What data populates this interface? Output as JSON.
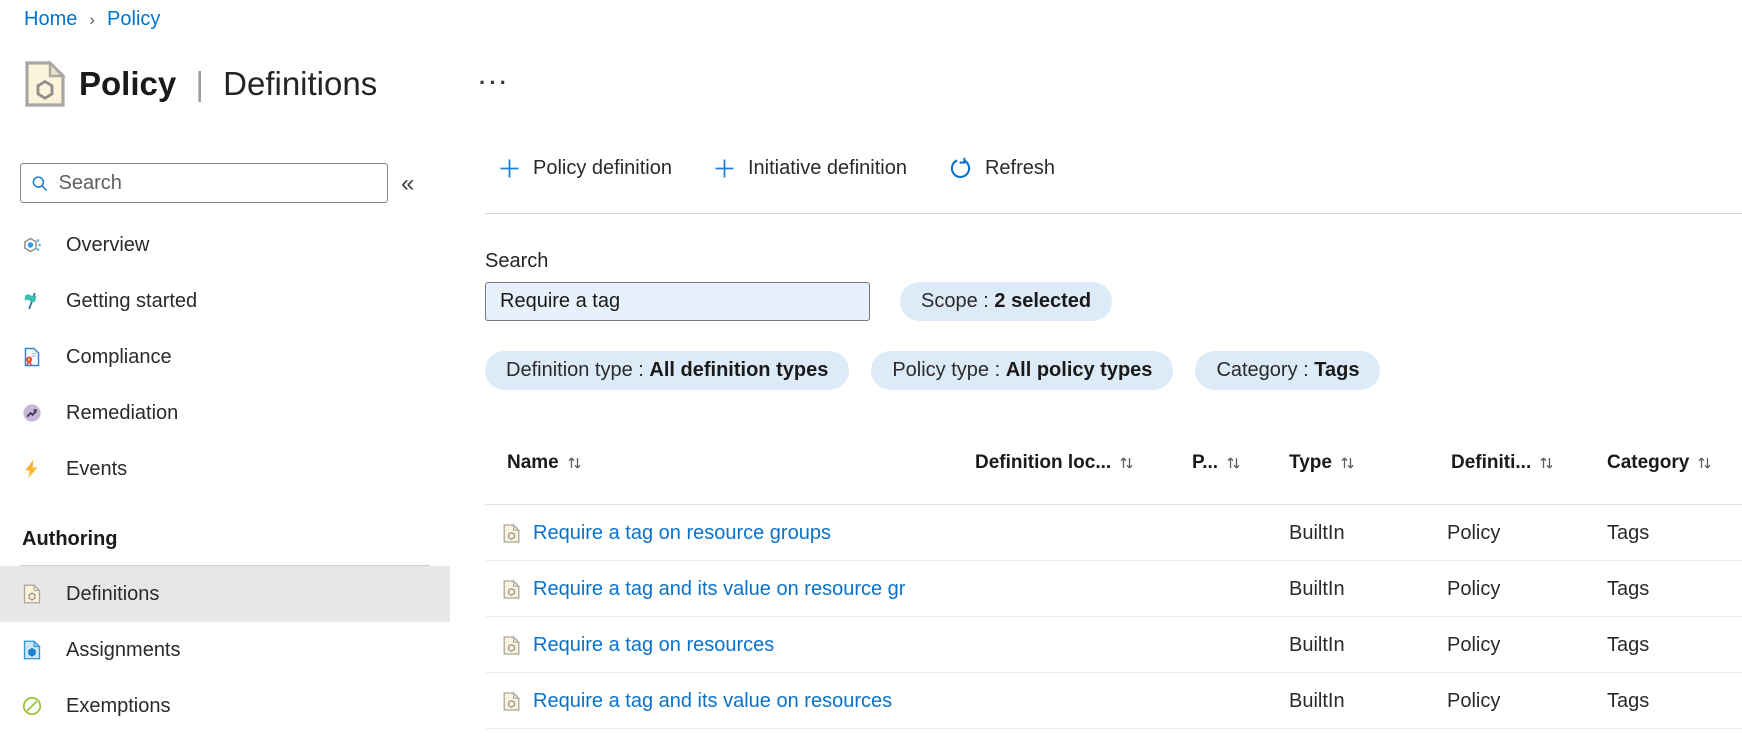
{
  "breadcrumb": {
    "items": [
      "Home",
      "Policy"
    ],
    "separator": "›"
  },
  "header": {
    "title_bold": "Policy",
    "separator": "|",
    "title_rest": "Definitions",
    "more_label": "···"
  },
  "sidebar": {
    "search_placeholder": "Search",
    "collapse_glyph": "«",
    "items": [
      {
        "label": "Overview",
        "icon": "overview-icon"
      },
      {
        "label": "Getting started",
        "icon": "getting-started-icon"
      },
      {
        "label": "Compliance",
        "icon": "compliance-icon"
      },
      {
        "label": "Remediation",
        "icon": "remediation-icon"
      },
      {
        "label": "Events",
        "icon": "events-icon"
      }
    ],
    "section_header": "Authoring",
    "authoring_items": [
      {
        "label": "Definitions",
        "icon": "definitions-icon",
        "selected": true
      },
      {
        "label": "Assignments",
        "icon": "assignments-icon",
        "selected": false
      },
      {
        "label": "Exemptions",
        "icon": "exemptions-icon",
        "selected": false
      }
    ]
  },
  "toolbar": {
    "policy_definition_label": "Policy definition",
    "initiative_definition_label": "Initiative definition",
    "refresh_label": "Refresh"
  },
  "filters": {
    "search_label": "Search",
    "search_value": "Require a tag",
    "pill_separator": " : ",
    "pills": [
      {
        "label": "Scope",
        "value": "2 selected"
      },
      {
        "label": "Definition type",
        "value": "All definition types"
      },
      {
        "label": "Policy type",
        "value": "All policy types"
      },
      {
        "label": "Category",
        "value": "Tags"
      }
    ]
  },
  "table": {
    "columns": [
      "Name",
      "Definition loc...",
      "P...",
      "Type",
      "Definiti...",
      "Category"
    ],
    "rows": [
      {
        "name": "Require a tag on resource groups",
        "type": "BuiltIn",
        "definition": "Policy",
        "category": "Tags"
      },
      {
        "name": "Require a tag and its value on resource gr",
        "type": "BuiltIn",
        "definition": "Policy",
        "category": "Tags"
      },
      {
        "name": "Require a tag on resources",
        "type": "BuiltIn",
        "definition": "Policy",
        "category": "Tags"
      },
      {
        "name": "Require a tag and its value on resources",
        "type": "BuiltIn",
        "definition": "Policy",
        "category": "Tags"
      }
    ]
  },
  "colors": {
    "accent_blue": "#0078d4",
    "link_blue": "#0b72c9",
    "pill_background": "#ddebf9",
    "input_background": "#e7f1fb",
    "selected_item_background": "#e7e7e7",
    "doc_icon_fill": "#fbf3da"
  }
}
